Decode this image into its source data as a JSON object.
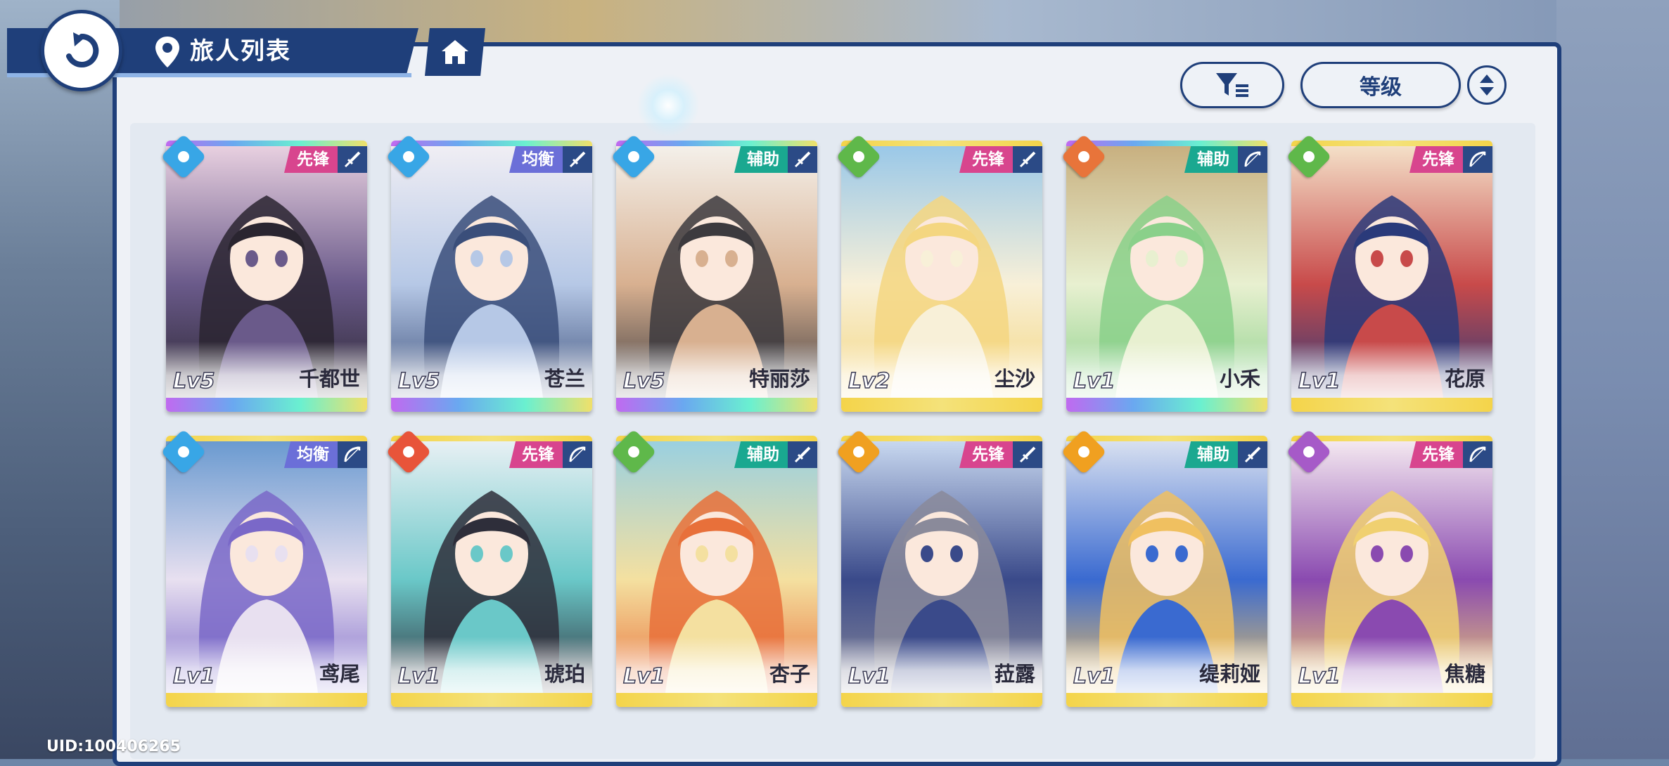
{
  "header": {
    "title": "旅人列表"
  },
  "toolbar": {
    "sort_label": "等级"
  },
  "uid": "UID:100406265",
  "role_colors": {
    "先锋": "#d8458e",
    "均衡": "#6b6fd8",
    "辅助": "#1aa890"
  },
  "element_colors": {
    "water": "#38a6e6",
    "wind": "#5fb84a",
    "earth": "#e8743a",
    "fire": "#e8543a",
    "light": "#f0a020",
    "dark": "#a65ac8"
  },
  "characters": [
    {
      "name": "千都世",
      "level": "Lv5",
      "role": "先锋",
      "element": "water",
      "weapon": "sword"
    },
    {
      "name": "苍兰",
      "level": "Lv5",
      "role": "均衡",
      "element": "water",
      "weapon": "sword"
    },
    {
      "name": "特丽莎",
      "level": "Lv5",
      "role": "辅助",
      "element": "water",
      "weapon": "sword"
    },
    {
      "name": "尘沙",
      "level": "Lv2",
      "role": "先锋",
      "element": "wind",
      "weapon": "sword"
    },
    {
      "name": "小禾",
      "level": "Lv1",
      "role": "辅助",
      "element": "earth",
      "weapon": "bow"
    },
    {
      "name": "花原",
      "level": "Lv1",
      "role": "先锋",
      "element": "wind",
      "weapon": "bow"
    },
    {
      "name": "鸢尾",
      "level": "Lv1",
      "role": "均衡",
      "element": "water",
      "weapon": "bow"
    },
    {
      "name": "琥珀",
      "level": "Lv1",
      "role": "先锋",
      "element": "fire",
      "weapon": "bow"
    },
    {
      "name": "杏子",
      "level": "Lv1",
      "role": "辅助",
      "element": "wind",
      "weapon": "sword"
    },
    {
      "name": "菈露",
      "level": "Lv1",
      "role": "先锋",
      "element": "light",
      "weapon": "sword"
    },
    {
      "name": "缇莉娅",
      "level": "Lv1",
      "role": "辅助",
      "element": "light",
      "weapon": "sword"
    },
    {
      "name": "焦糖",
      "level": "Lv1",
      "role": "先锋",
      "element": "dark",
      "weapon": "bow"
    }
  ]
}
